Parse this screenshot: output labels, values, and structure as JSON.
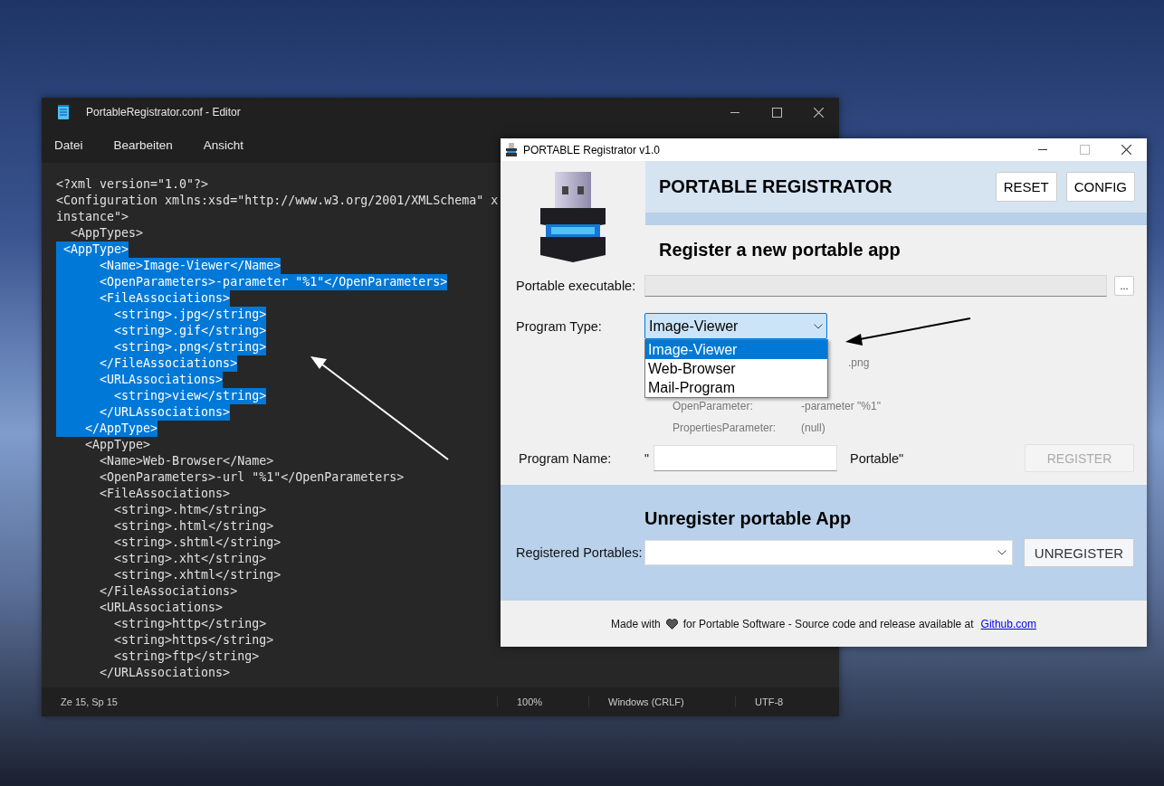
{
  "editor": {
    "title": "PortableRegistrator.conf - Editor",
    "menu": [
      "Datei",
      "Bearbeiten",
      "Ansicht"
    ],
    "lines": [
      {
        "text": "<?xml version=\"1.0\"?>",
        "selected": false
      },
      {
        "text": "<Configuration xmlns:xsd=\"http://www.w3.org/2001/XMLSchema\" x",
        "selected": false
      },
      {
        "text": "instance\">",
        "selected": false
      },
      {
        "text": "  <AppTypes>",
        "selected": false
      },
      {
        "text": " <AppType>",
        "selected": true
      },
      {
        "text": "      <Name>Image-Viewer</Name>",
        "selected": true
      },
      {
        "text": "      <OpenParameters>-parameter \"%1\"</OpenParameters>",
        "selected": true
      },
      {
        "text": "      <FileAssociations>",
        "selected": true
      },
      {
        "text": "        <string>.jpg</string>",
        "selected": true
      },
      {
        "text": "        <string>.gif</string>",
        "selected": true
      },
      {
        "text": "        <string>.png</string>",
        "selected": true
      },
      {
        "text": "      </FileAssociations>",
        "selected": true
      },
      {
        "text": "      <URLAssociations>",
        "selected": true
      },
      {
        "text": "        <string>view</string>",
        "selected": true
      },
      {
        "text": "      </URLAssociations>",
        "selected": true
      },
      {
        "text": "    </AppType>",
        "selected": true
      },
      {
        "text": "    <AppType>",
        "selected": false
      },
      {
        "text": "      <Name>Web-Browser</Name>",
        "selected": false
      },
      {
        "text": "      <OpenParameters>-url \"%1\"</OpenParameters>",
        "selected": false
      },
      {
        "text": "      <FileAssociations>",
        "selected": false
      },
      {
        "text": "        <string>.htm</string>",
        "selected": false
      },
      {
        "text": "        <string>.html</string>",
        "selected": false
      },
      {
        "text": "        <string>.shtml</string>",
        "selected": false
      },
      {
        "text": "        <string>.xht</string>",
        "selected": false
      },
      {
        "text": "        <string>.xhtml</string>",
        "selected": false
      },
      {
        "text": "      </FileAssociations>",
        "selected": false
      },
      {
        "text": "      <URLAssociations>",
        "selected": false
      },
      {
        "text": "        <string>http</string>",
        "selected": false
      },
      {
        "text": "        <string>https</string>",
        "selected": false
      },
      {
        "text": "        <string>ftp</string>",
        "selected": false
      },
      {
        "text": "      </URLAssociations>",
        "selected": false
      }
    ],
    "status_bar": [
      "Ze 15, Sp 15",
      "100%",
      "Windows (CRLF)",
      "UTF-8"
    ]
  },
  "registrar": {
    "title": "PORTABLE Registrator v1.0",
    "heading": "PORTABLE REGISTRATOR",
    "header_buttons": [
      "RESET",
      "CONFIG"
    ],
    "register": {
      "heading": "Register a new portable app",
      "executable": {
        "label": "Portable executable:",
        "browse_button": "..."
      },
      "program_type": {
        "label": "Program Type:",
        "value": "Image-Viewer",
        "expanded": true,
        "options": [
          {
            "label": "Image-Viewer",
            "selected": true
          },
          {
            "label": "Web-Browser",
            "selected": false
          },
          {
            "label": "Mail-Program",
            "selected": false
          }
        ]
      },
      "details": [
        {
          "kind": "cut",
          "value": ".png"
        },
        {
          "kind": "hidden"
        },
        {
          "kind": "full",
          "label": "OpenParameter:",
          "value": "-parameter \"%1\""
        },
        {
          "kind": "full",
          "label": "PropertiesParameter:",
          "value": "(null)"
        }
      ],
      "program_name": {
        "label": "Program Name:",
        "prefix": "\"",
        "suffix": "Portable\""
      },
      "register_button": {
        "label": "REGISTER",
        "disabled": true
      }
    },
    "unregister": {
      "heading": "Unregister portable App",
      "label": "Registered Portables:",
      "button": "UNREGISTER"
    },
    "footer": {
      "text_before": "Made with",
      "text_after": "for Portable Software - Source code and release available at",
      "link": "Github.com"
    }
  }
}
